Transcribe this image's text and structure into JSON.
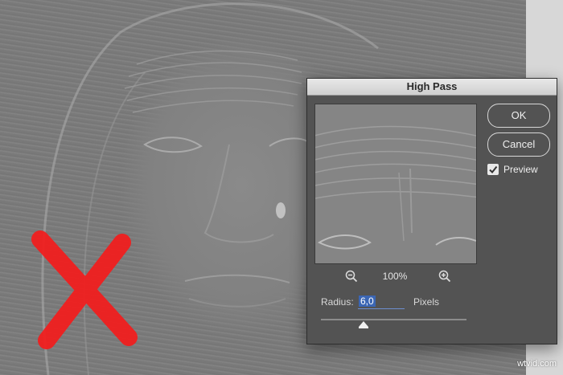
{
  "dialog": {
    "title": "High Pass",
    "ok_label": "OK",
    "cancel_label": "Cancel",
    "preview_label": "Preview",
    "preview_checked": true,
    "zoom_level": "100%",
    "radius_label": "Radius:",
    "radius_value": "6,0",
    "radius_unit": "Pixels",
    "icons": {
      "zoom_out": "zoom-out-icon",
      "zoom_in": "zoom-in-icon",
      "checkmark": "checkmark-icon"
    }
  },
  "overlay": {
    "mark": "cross-mark",
    "color": "#f41c1c"
  },
  "watermark": "wtvid.com",
  "colors": {
    "dialog_bg": "#535353",
    "input_selection": "#3b66b4",
    "photo_bg": "#7c7c7c"
  }
}
